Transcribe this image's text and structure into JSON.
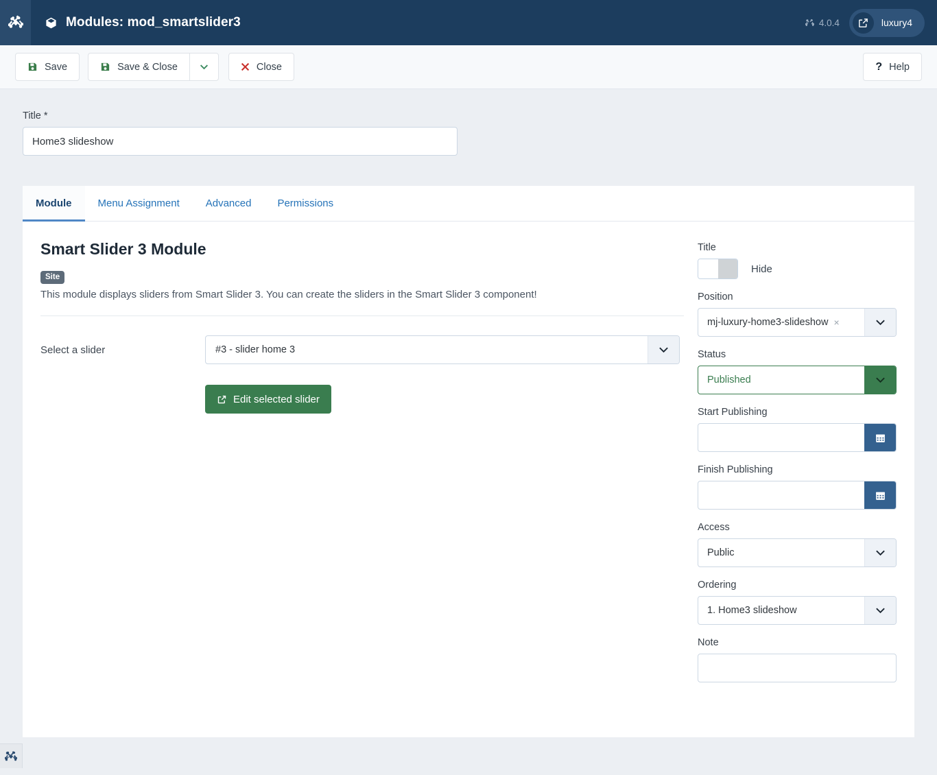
{
  "header": {
    "title": "Modules: mod_smartslider3",
    "title_icon": "cube-icon",
    "logo_icon": "joomla-logo-icon",
    "version": "4.0.4",
    "version_icon": "joomla-mark-icon",
    "user_name": "luxury4",
    "user_icon": "external-link-icon"
  },
  "toolbar": {
    "save_label": "Save",
    "save_icon": "floppy-disk-icon",
    "save_close_label": "Save & Close",
    "save_close_icon": "floppy-disk-icon",
    "dropdown_icon": "chevron-down-icon",
    "close_label": "Close",
    "close_icon": "x-mark-icon",
    "help_label": "Help",
    "help_icon": "question-mark-icon"
  },
  "form": {
    "title_label": "Title *",
    "title_value": "Home3 slideshow"
  },
  "tabs": [
    {
      "label": "Module",
      "active": true
    },
    {
      "label": "Menu Assignment",
      "active": false
    },
    {
      "label": "Advanced",
      "active": false
    },
    {
      "label": "Permissions",
      "active": false
    }
  ],
  "module": {
    "heading": "Smart Slider 3 Module",
    "badge": "Site",
    "description": "This module displays sliders from Smart Slider 3. You can create the sliders in the Smart Slider 3 component!",
    "select_slider_label": "Select a slider",
    "select_slider_value": "#3 - slider home 3",
    "select_caret_icon": "chevron-down-icon",
    "edit_button_label": "Edit selected slider",
    "edit_button_icon": "external-link-icon"
  },
  "side": {
    "title_label": "Title",
    "title_toggle_text": "Hide",
    "position_label": "Position",
    "position_value": "mj-luxury-home3-slideshow",
    "position_clear": "×",
    "status_label": "Status",
    "status_value": "Published",
    "start_publishing_label": "Start Publishing",
    "start_publishing_value": "",
    "finish_publishing_label": "Finish Publishing",
    "finish_publishing_value": "",
    "calendar_icon": "calendar-icon",
    "access_label": "Access",
    "access_value": "Public",
    "ordering_label": "Ordering",
    "ordering_value": "1. Home3 slideshow",
    "note_label": "Note",
    "note_value": "",
    "caret_icon": "chevron-down-icon"
  },
  "footer": {
    "toggle_icon": "joomla-logo-icon"
  },
  "colors": {
    "header_bg": "#1c3d5e",
    "accent_blue": "#2573b8",
    "green": "#3a7d4f",
    "red": "#c9322d",
    "calendar_blue": "#34618f",
    "page_bg": "#eceff3"
  }
}
